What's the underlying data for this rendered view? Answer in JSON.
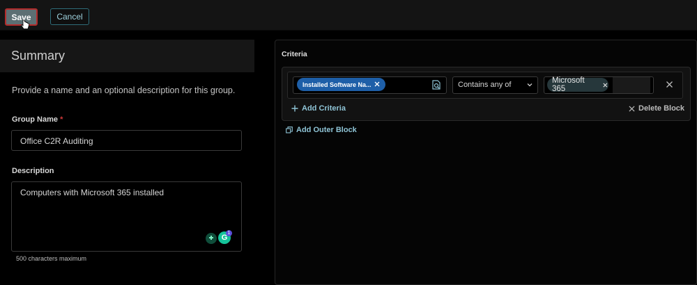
{
  "toolbar": {
    "save_label": "Save",
    "cancel_label": "Cancel"
  },
  "summary": {
    "title": "Summary",
    "help_text": "Provide a name and an optional description for this group.",
    "group_name_label": "Group Name",
    "required_mark": "*",
    "group_name_value": "Office C2R Auditing",
    "description_label": "Description",
    "description_value": "Computers with Microsoft 365 installed",
    "max_chars_note": "500 characters maximum",
    "extension_badge_count": "1"
  },
  "criteria": {
    "title": "Criteria",
    "field_chip": "Installed Software Na...",
    "operator_value": "Contains any of",
    "value_chip": "Microsoft 365",
    "add_criteria_label": "Add Criteria",
    "delete_block_label": "Delete Block",
    "add_outer_block_label": "Add Outer Block"
  },
  "colors": {
    "accent_link": "#8fc4d6",
    "chip_blue": "#1e5fa8",
    "save_button": "#5c6f73",
    "required": "#d33a3a"
  }
}
